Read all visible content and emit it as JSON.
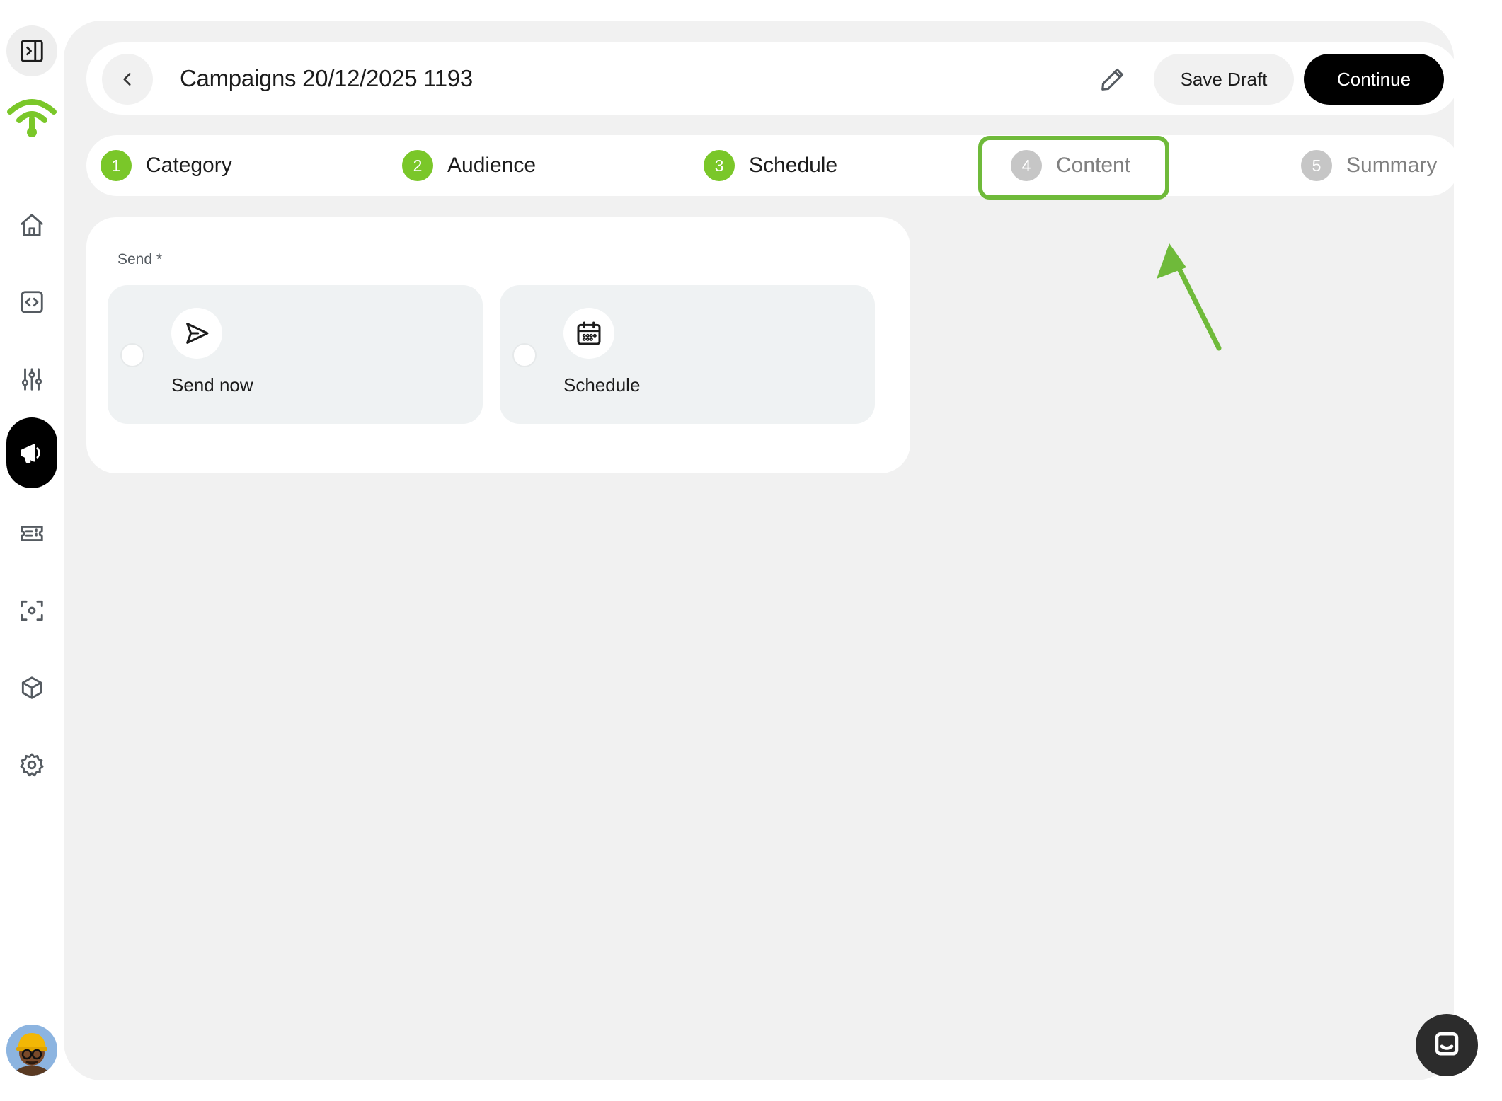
{
  "header": {
    "title": "Campaigns 20/12/2025 1193",
    "save_draft_label": "Save Draft",
    "continue_label": "Continue"
  },
  "steps": [
    {
      "number": "1",
      "label": "Category",
      "state": "complete"
    },
    {
      "number": "2",
      "label": "Audience",
      "state": "complete"
    },
    {
      "number": "3",
      "label": "Schedule",
      "state": "complete"
    },
    {
      "number": "4",
      "label": "Content",
      "state": "pending"
    },
    {
      "number": "5",
      "label": "Summary",
      "state": "pending"
    }
  ],
  "send": {
    "label": "Send *",
    "options": [
      {
        "label": "Send now",
        "icon": "send-icon",
        "selected": false
      },
      {
        "label": "Schedule",
        "icon": "calendar-icon",
        "selected": false
      }
    ]
  },
  "sidebar": {
    "items": [
      {
        "icon": "sidebar-toggle-icon"
      },
      {
        "icon": "home-icon"
      },
      {
        "icon": "code-icon"
      },
      {
        "icon": "sliders-icon"
      },
      {
        "icon": "megaphone-icon",
        "active": true
      },
      {
        "icon": "ticket-icon"
      },
      {
        "icon": "scan-icon"
      },
      {
        "icon": "box-icon"
      },
      {
        "icon": "gear-icon"
      }
    ]
  },
  "colors": {
    "accent_green": "#7ac729",
    "annotation_green": "#6fba3a",
    "primary_button": "#000000",
    "inactive_step": "#c6c6c6",
    "background": "#f1f1f1"
  }
}
